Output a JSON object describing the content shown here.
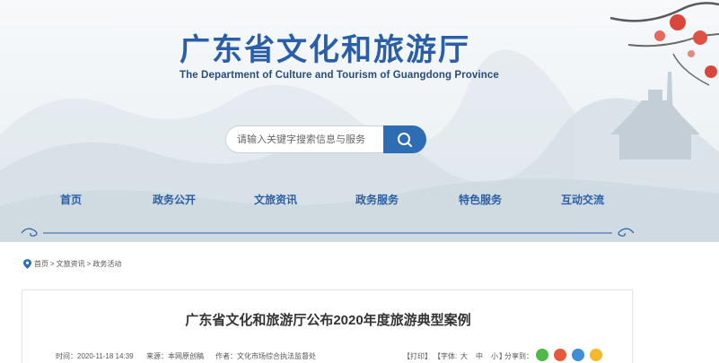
{
  "header": {
    "title": "广东省文化和旅游厅",
    "subtitle": "The Department of Culture and Tourism of Guangdong Province"
  },
  "search": {
    "placeholder": "请输入关键字搜索信息与服务"
  },
  "nav": {
    "items": [
      "首页",
      "政务公开",
      "文旅资讯",
      "政务服务",
      "特色服务",
      "互动交流"
    ]
  },
  "breadcrumb": {
    "items": [
      "首页",
      "文旅资讯",
      "政务活动"
    ],
    "separator": ">"
  },
  "article": {
    "title": "广东省文化和旅游厅公布2020年度旅游典型案例",
    "time": "时间：2020-11-18 14:39",
    "source": "来源：本网原创稿",
    "author": "作者：文化市场综合执法监督处",
    "print": "【打印】",
    "font_label": "【字体:",
    "font_large": "大",
    "font_medium": "中",
    "font_small": "小",
    "font_close": "】",
    "share_label": "分享到："
  },
  "colors": {
    "brand_blue": "#2a5fa8",
    "search_button": "#2e6db4",
    "share_wechat": "#4fb84a",
    "share_weibo": "#e8593b",
    "share_qq": "#3d8fd8",
    "share_qzone": "#f5b72b"
  },
  "icons": {
    "search": "magnifier",
    "location": "map-pin",
    "share": [
      "wechat-icon",
      "weibo-icon",
      "qq-icon",
      "qzone-icon"
    ]
  }
}
